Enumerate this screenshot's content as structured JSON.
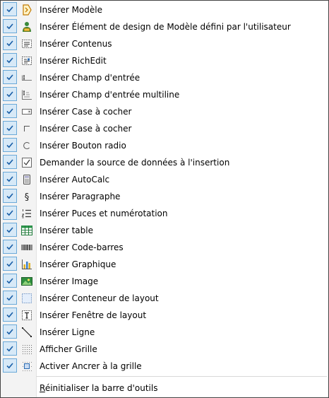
{
  "menu": {
    "items": [
      {
        "label": "Insérer Modèle",
        "icon": "template-icon",
        "checked": true
      },
      {
        "label": "Insérer Élément de design de Modèle défini par l'utilisateur",
        "icon": "user-defined-template-icon",
        "checked": true
      },
      {
        "label": "Insérer Contenus",
        "icon": "contents-icon",
        "checked": true
      },
      {
        "label": "Insérer RichEdit",
        "icon": "richedit-icon",
        "checked": true
      },
      {
        "label": "Insérer Champ d'entrée",
        "icon": "input-field-icon",
        "checked": true
      },
      {
        "label": "Insérer Champ d'entrée multiline",
        "icon": "multiline-input-icon",
        "checked": true
      },
      {
        "label": "Insérer Case à cocher",
        "icon": "combo-box-icon",
        "checked": true
      },
      {
        "label": "Insérer Case à cocher",
        "icon": "checkbox-icon",
        "checked": true
      },
      {
        "label": "Insérer Bouton radio",
        "icon": "radio-button-icon",
        "checked": true
      },
      {
        "label": "Demander la source de données à l'insertion",
        "icon": "data-source-icon",
        "checked": true
      },
      {
        "label": "Insérer AutoCalc",
        "icon": "calculator-icon",
        "checked": true
      },
      {
        "label": "Insérer Paragraphe",
        "icon": "paragraph-icon",
        "checked": true
      },
      {
        "label": "Insérer Puces et numérotation",
        "icon": "bullets-numbering-icon",
        "checked": true
      },
      {
        "label": "Insérer table",
        "icon": "table-icon",
        "checked": true
      },
      {
        "label": "Insérer Code-barres",
        "icon": "barcode-icon",
        "checked": true
      },
      {
        "label": "Insérer Graphique",
        "icon": "chart-icon",
        "checked": true
      },
      {
        "label": "Insérer Image",
        "icon": "image-icon",
        "checked": true
      },
      {
        "label": "Insérer Conteneur de layout",
        "icon": "layout-container-icon",
        "checked": true
      },
      {
        "label": "Insérer Fenêtre de layout",
        "icon": "layout-box-icon",
        "checked": true
      },
      {
        "label": "Insérer Ligne",
        "icon": "line-icon",
        "checked": true
      },
      {
        "label": "Afficher Grille",
        "icon": "grid-icon",
        "checked": true
      },
      {
        "label": "Activer Ancrer à la grille",
        "icon": "snap-grid-icon",
        "checked": true
      }
    ],
    "reset": {
      "mnemonic": "R",
      "rest": "éinitialiser la barre d'outils"
    }
  }
}
